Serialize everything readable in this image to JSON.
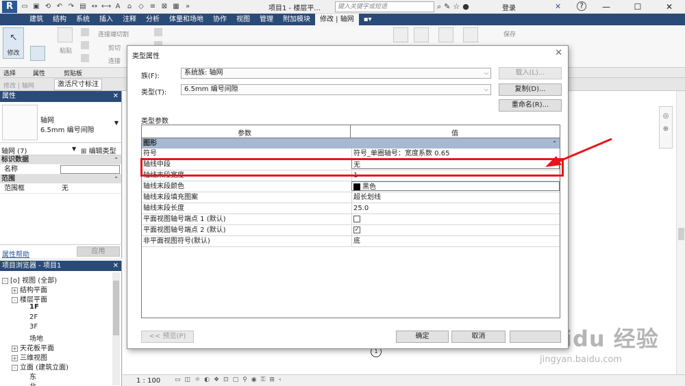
{
  "app": {
    "logo_letter": "R",
    "doc_title": "项目1 - 楼层平...",
    "search_placeholder": "键入关键字或短语",
    "login": "登录",
    "help": "?"
  },
  "ribbon": {
    "tabs": [
      "建筑",
      "结构",
      "系统",
      "插入",
      "注释",
      "分析",
      "体量和场地",
      "协作",
      "视图",
      "管理",
      "附加模块"
    ],
    "active_tab": "修改 | 轴网",
    "modify_label": "修改",
    "paste_label": "粘贴",
    "join_label": "连接端切割",
    "cut_label": "剪切",
    "connect_label": "连接",
    "save_label": "保存",
    "groups": {
      "select": "选择",
      "properties": "属性",
      "clipboard": "剪贴板"
    }
  },
  "context_bar": {
    "mode": "修改 | 轴网",
    "active_tab": "激活尺寸标注"
  },
  "properties": {
    "title": "属性",
    "type_family": "轴网",
    "type_name": "6.5mm 编号间隙",
    "instance_selector": "轴网 (7)",
    "edit_type": "编辑类型",
    "groups": [
      {
        "name": "标识数据",
        "rows": [
          {
            "key": "名称",
            "value": ""
          }
        ]
      },
      {
        "name": "范围",
        "rows": [
          {
            "key": "范围框",
            "value": "无"
          }
        ]
      }
    ],
    "help_link": "属性帮助",
    "apply_button": "应用"
  },
  "browser": {
    "title": "项目浏览器 - 项目1",
    "items": [
      {
        "label": "视图 (全部)",
        "toggle": "-",
        "icon": "[o]"
      },
      {
        "label": "结构平面",
        "toggle": "+"
      },
      {
        "label": "楼层平面",
        "toggle": "-"
      },
      {
        "label": "1F",
        "bold": true
      },
      {
        "label": "2F"
      },
      {
        "label": "3F"
      },
      {
        "label": "场地"
      },
      {
        "label": "天花板平面",
        "toggle": "+"
      },
      {
        "label": "三维视图",
        "toggle": "+"
      },
      {
        "label": "立面 (建筑立面)",
        "toggle": "-"
      },
      {
        "label": "东"
      },
      {
        "label": "北"
      }
    ]
  },
  "dialog": {
    "title": "类型属性",
    "family_label": "族(F):",
    "family_value": "系统族: 轴网",
    "type_label": "类型(T):",
    "type_value": "6.5mm 编号间隙",
    "load_button": "载入(L)...",
    "duplicate_button": "复制(D)...",
    "rename_button": "重命名(R)...",
    "params_label": "类型参数",
    "col_param": "参数",
    "col_value": "值",
    "group_name": "图形",
    "rows": [
      {
        "key": "符号",
        "value": "符号_单圈轴号：宽度系数 0.65"
      },
      {
        "key": "轴线中段",
        "value": "无",
        "box": true
      },
      {
        "key": "轴线末段宽度",
        "value": "1"
      },
      {
        "key": "轴线末段颜色",
        "value": "黑色",
        "swatch": true,
        "box": true
      },
      {
        "key": "轴线末段填充图案",
        "value": "超长划线"
      },
      {
        "key": "轴线末段长度",
        "value": "25.0"
      },
      {
        "key": "平面视图轴号端点 1 (默认)",
        "check": ""
      },
      {
        "key": "平面视图轴号端点 2 (默认)",
        "check": "✓"
      },
      {
        "key": "非平面视图符号(默认)",
        "value": "底"
      }
    ],
    "preview_button": "<< 预览(P)",
    "ok_button": "确定",
    "cancel_button": "取消"
  },
  "status": {
    "scale": "1 : 100"
  },
  "canvas": {
    "grid_marker": "1"
  },
  "watermark": {
    "brand": "Baidu 经验",
    "url": "jingyan.baidu.com"
  },
  "colors": {
    "ribbon_blue": "#2a4a77",
    "group_row": "#a7b9d1",
    "highlight": "#e8141b"
  }
}
